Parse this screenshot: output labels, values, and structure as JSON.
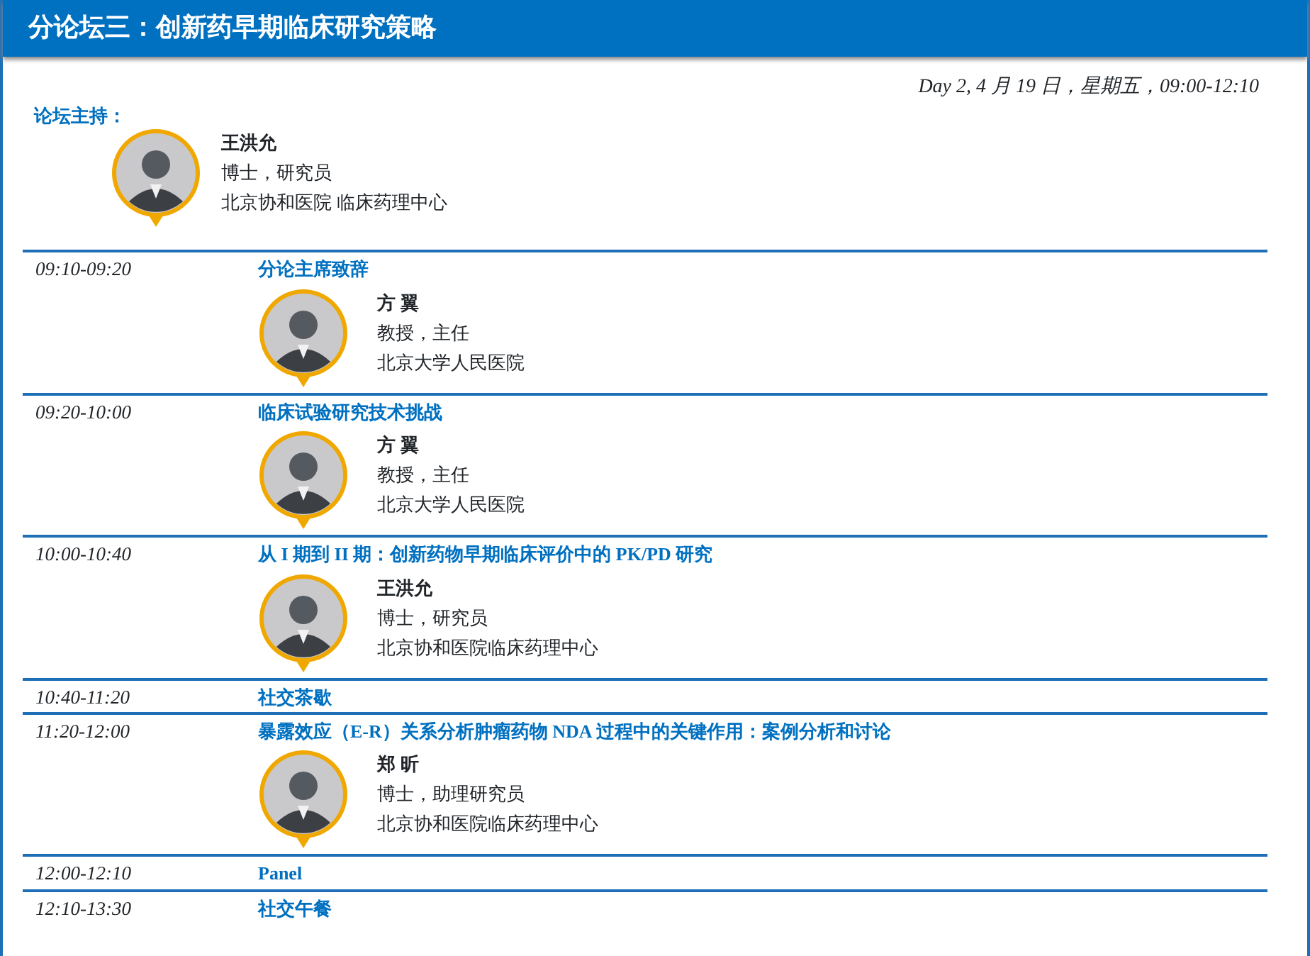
{
  "header": {
    "title": "分论坛三：创新药早期临床研究策略"
  },
  "date_line": "Day 2, 4 月 19 日，星期五，09:00-12:10",
  "moderator": {
    "label": "论坛主持：",
    "speakers": [
      {
        "name": "王洪允",
        "title": "博士，研究员",
        "affiliation": "北京协和医院  临床药理中心"
      }
    ]
  },
  "sessions": [
    {
      "time": "09:10-09:20",
      "title": "分论主席致辞",
      "speakers": [
        {
          "name": "方  翼",
          "title": "教授，主任",
          "affiliation": "北京大学人民医院"
        }
      ]
    },
    {
      "time": "09:20-10:00",
      "title": "临床试验研究技术挑战",
      "speakers": [
        {
          "name": "方  翼",
          "title": "教授，主任",
          "affiliation": "北京大学人民医院"
        }
      ]
    },
    {
      "time": "10:00-10:40",
      "title": "从 I 期到 II 期：创新药物早期临床评价中的 PK/PD 研究",
      "speakers": [
        {
          "name": "王洪允",
          "title": "博士，研究员",
          "affiliation": "北京协和医院临床药理中心"
        }
      ]
    },
    {
      "time": "10:40-11:20",
      "title": "社交茶歇"
    },
    {
      "time": "11:20-12:00",
      "title": "暴露效应（E-R）关系分析肿瘤药物 NDA 过程中的关键作用：案例分析和讨论",
      "speakers": [
        {
          "name": "郑  昕",
          "title": "博士，助理研究员",
          "affiliation": "北京协和医院临床药理中心"
        }
      ]
    },
    {
      "time": "12:00-12:10",
      "title": "Panel"
    },
    {
      "time": "12:10-13:30",
      "title": "社交午餐"
    }
  ]
}
